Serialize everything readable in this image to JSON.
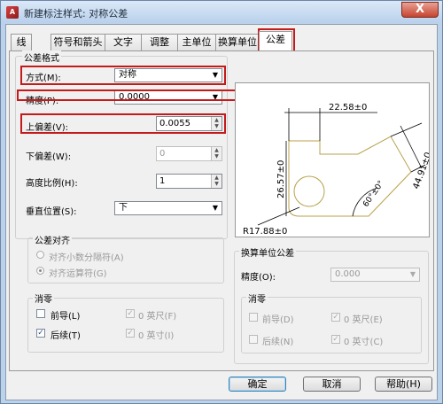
{
  "window": {
    "title": "新建标注样式: 对称公差",
    "close_glyph": "X"
  },
  "tabs": [
    "线",
    "符号和箭头",
    "文字",
    "调整",
    "主单位",
    "换算单位",
    "公差"
  ],
  "active_tab": "公差",
  "tolerance_format": {
    "group_title": "公差格式",
    "method_label": "方式(M):",
    "method_value": "对称",
    "precision_label": "精度(P):",
    "precision_value": "0.0000",
    "upper_label": "上偏差(V):",
    "upper_value": "0.0055",
    "lower_label": "下偏差(W):",
    "lower_value": "0",
    "scale_label": "高度比例(H):",
    "scale_value": "1",
    "vpos_label": "垂直位置(S):",
    "vpos_value": "下"
  },
  "tolerance_align": {
    "group_title": "公差对齐",
    "opt1": "对齐小数分隔符(A)",
    "opt2": "对齐运算符(G)",
    "selected": "opt2"
  },
  "zero_suppress": {
    "group_title": "消零",
    "leading": "前导(L)",
    "leading_checked": false,
    "trailing": "后续(T)",
    "trailing_checked": true,
    "feet": "0 英尺(F)",
    "feet_checked": true,
    "inches": "0 英寸(I)",
    "inches_checked": true
  },
  "alt_units": {
    "group_title": "换算单位公差",
    "precision_label": "精度(O):",
    "precision_value": "0.000",
    "zero_group_title": "消零",
    "leading": "前导(D)",
    "leading_checked": false,
    "trailing": "后续(N)",
    "trailing_checked": false,
    "feet": "0 英尺(E)",
    "feet_checked": true,
    "inches": "0 英寸(C)",
    "inches_checked": true
  },
  "preview": {
    "dim_top": "22.58±0",
    "dim_left": "26.57±0",
    "dim_right": "44.91±0",
    "dim_angle": "60°±0°",
    "dim_radius": "R17.88±0"
  },
  "buttons": {
    "ok": "确定",
    "cancel": "取消",
    "help": "帮助(H)"
  },
  "colors": {
    "highlight": "#c41a1a",
    "part_outline": "#b8a04a"
  }
}
